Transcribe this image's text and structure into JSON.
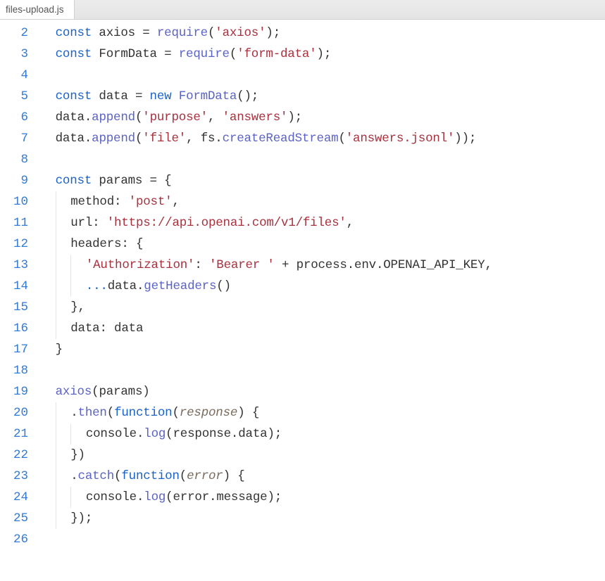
{
  "tab": {
    "title": "files-upload.js"
  },
  "lines": [
    {
      "n": "2",
      "indent": 0,
      "tokens": [
        {
          "t": "const ",
          "c": "kw"
        },
        {
          "t": "axios ",
          "c": "def"
        },
        {
          "t": "= ",
          "c": "op"
        },
        {
          "t": "require",
          "c": "fn"
        },
        {
          "t": "(",
          "c": "op"
        },
        {
          "t": "'axios'",
          "c": "str"
        },
        {
          "t": ");",
          "c": "op"
        }
      ]
    },
    {
      "n": "3",
      "indent": 0,
      "tokens": [
        {
          "t": "const ",
          "c": "kw"
        },
        {
          "t": "FormData ",
          "c": "def"
        },
        {
          "t": "= ",
          "c": "op"
        },
        {
          "t": "require",
          "c": "fn"
        },
        {
          "t": "(",
          "c": "op"
        },
        {
          "t": "'form-data'",
          "c": "str"
        },
        {
          "t": ");",
          "c": "op"
        }
      ]
    },
    {
      "n": "4",
      "indent": 0,
      "tokens": []
    },
    {
      "n": "5",
      "indent": 0,
      "tokens": [
        {
          "t": "const ",
          "c": "kw"
        },
        {
          "t": "data ",
          "c": "def"
        },
        {
          "t": "= ",
          "c": "op"
        },
        {
          "t": "new ",
          "c": "kw"
        },
        {
          "t": "FormData",
          "c": "fn"
        },
        {
          "t": "();",
          "c": "op"
        }
      ]
    },
    {
      "n": "6",
      "indent": 0,
      "tokens": [
        {
          "t": "data",
          "c": "def"
        },
        {
          "t": ".",
          "c": "dot"
        },
        {
          "t": "append",
          "c": "fn"
        },
        {
          "t": "(",
          "c": "op"
        },
        {
          "t": "'purpose'",
          "c": "str"
        },
        {
          "t": ", ",
          "c": "op"
        },
        {
          "t": "'answers'",
          "c": "str"
        },
        {
          "t": ");",
          "c": "op"
        }
      ]
    },
    {
      "n": "7",
      "indent": 0,
      "tokens": [
        {
          "t": "data",
          "c": "def"
        },
        {
          "t": ".",
          "c": "dot"
        },
        {
          "t": "append",
          "c": "fn"
        },
        {
          "t": "(",
          "c": "op"
        },
        {
          "t": "'file'",
          "c": "str"
        },
        {
          "t": ", ",
          "c": "op"
        },
        {
          "t": "fs",
          "c": "def"
        },
        {
          "t": ".",
          "c": "dot"
        },
        {
          "t": "createReadStream",
          "c": "fn"
        },
        {
          "t": "(",
          "c": "op"
        },
        {
          "t": "'answers.jsonl'",
          "c": "str"
        },
        {
          "t": "));",
          "c": "op"
        }
      ]
    },
    {
      "n": "8",
      "indent": 0,
      "tokens": []
    },
    {
      "n": "9",
      "indent": 0,
      "tokens": [
        {
          "t": "const ",
          "c": "kw"
        },
        {
          "t": "params ",
          "c": "def"
        },
        {
          "t": "= {",
          "c": "op"
        }
      ]
    },
    {
      "n": "10",
      "indent": 1,
      "tokens": [
        {
          "t": "method",
          "c": "prop"
        },
        {
          "t": ": ",
          "c": "op"
        },
        {
          "t": "'post'",
          "c": "str"
        },
        {
          "t": ",",
          "c": "op"
        }
      ]
    },
    {
      "n": "11",
      "indent": 1,
      "tokens": [
        {
          "t": "url",
          "c": "prop"
        },
        {
          "t": ": ",
          "c": "op"
        },
        {
          "t": "'https://api.openai.com/v1/files'",
          "c": "str"
        },
        {
          "t": ",",
          "c": "op"
        }
      ]
    },
    {
      "n": "12",
      "indent": 1,
      "tokens": [
        {
          "t": "headers",
          "c": "prop"
        },
        {
          "t": ": {",
          "c": "op"
        }
      ]
    },
    {
      "n": "13",
      "indent": 2,
      "tokens": [
        {
          "t": "'Authorization'",
          "c": "str"
        },
        {
          "t": ": ",
          "c": "op"
        },
        {
          "t": "'Bearer '",
          "c": "str"
        },
        {
          "t": " + ",
          "c": "op"
        },
        {
          "t": "process",
          "c": "def"
        },
        {
          "t": ".",
          "c": "dot"
        },
        {
          "t": "env",
          "c": "def"
        },
        {
          "t": ".",
          "c": "dot"
        },
        {
          "t": "OPENAI_API_KEY",
          "c": "def"
        },
        {
          "t": ",",
          "c": "op"
        }
      ]
    },
    {
      "n": "14",
      "indent": 2,
      "tokens": [
        {
          "t": "...",
          "c": "spread"
        },
        {
          "t": "data",
          "c": "def"
        },
        {
          "t": ".",
          "c": "dot"
        },
        {
          "t": "getHeaders",
          "c": "fn"
        },
        {
          "t": "()",
          "c": "op"
        }
      ]
    },
    {
      "n": "15",
      "indent": 1,
      "tokens": [
        {
          "t": "},",
          "c": "op"
        }
      ]
    },
    {
      "n": "16",
      "indent": 1,
      "tokens": [
        {
          "t": "data",
          "c": "prop"
        },
        {
          "t": ": ",
          "c": "op"
        },
        {
          "t": "data",
          "c": "def"
        }
      ]
    },
    {
      "n": "17",
      "indent": 0,
      "tokens": [
        {
          "t": "}",
          "c": "op"
        }
      ]
    },
    {
      "n": "18",
      "indent": 0,
      "tokens": []
    },
    {
      "n": "19",
      "indent": 0,
      "tokens": [
        {
          "t": "axios",
          "c": "fn"
        },
        {
          "t": "(",
          "c": "op"
        },
        {
          "t": "params",
          "c": "def"
        },
        {
          "t": ")",
          "c": "op"
        }
      ]
    },
    {
      "n": "20",
      "indent": 1,
      "tokens": [
        {
          "t": ".",
          "c": "dot"
        },
        {
          "t": "then",
          "c": "fn"
        },
        {
          "t": "(",
          "c": "op"
        },
        {
          "t": "function",
          "c": "kw"
        },
        {
          "t": "(",
          "c": "op"
        },
        {
          "t": "response",
          "c": "param"
        },
        {
          "t": ") {",
          "c": "op"
        }
      ]
    },
    {
      "n": "21",
      "indent": 2,
      "tokens": [
        {
          "t": "console",
          "c": "def"
        },
        {
          "t": ".",
          "c": "dot"
        },
        {
          "t": "log",
          "c": "fn"
        },
        {
          "t": "(",
          "c": "op"
        },
        {
          "t": "response",
          "c": "def"
        },
        {
          "t": ".",
          "c": "dot"
        },
        {
          "t": "data",
          "c": "def"
        },
        {
          "t": ");",
          "c": "op"
        }
      ]
    },
    {
      "n": "22",
      "indent": 1,
      "tokens": [
        {
          "t": "})",
          "c": "op"
        }
      ]
    },
    {
      "n": "23",
      "indent": 1,
      "tokens": [
        {
          "t": ".",
          "c": "dot"
        },
        {
          "t": "catch",
          "c": "fn"
        },
        {
          "t": "(",
          "c": "op"
        },
        {
          "t": "function",
          "c": "kw"
        },
        {
          "t": "(",
          "c": "op"
        },
        {
          "t": "error",
          "c": "param"
        },
        {
          "t": ") {",
          "c": "op"
        }
      ]
    },
    {
      "n": "24",
      "indent": 2,
      "tokens": [
        {
          "t": "console",
          "c": "def"
        },
        {
          "t": ".",
          "c": "dot"
        },
        {
          "t": "log",
          "c": "fn"
        },
        {
          "t": "(",
          "c": "op"
        },
        {
          "t": "error",
          "c": "def"
        },
        {
          "t": ".",
          "c": "dot"
        },
        {
          "t": "message",
          "c": "def"
        },
        {
          "t": ");",
          "c": "op"
        }
      ]
    },
    {
      "n": "25",
      "indent": 1,
      "tokens": [
        {
          "t": "});",
          "c": "op"
        }
      ]
    },
    {
      "n": "26",
      "indent": 0,
      "tokens": []
    }
  ]
}
